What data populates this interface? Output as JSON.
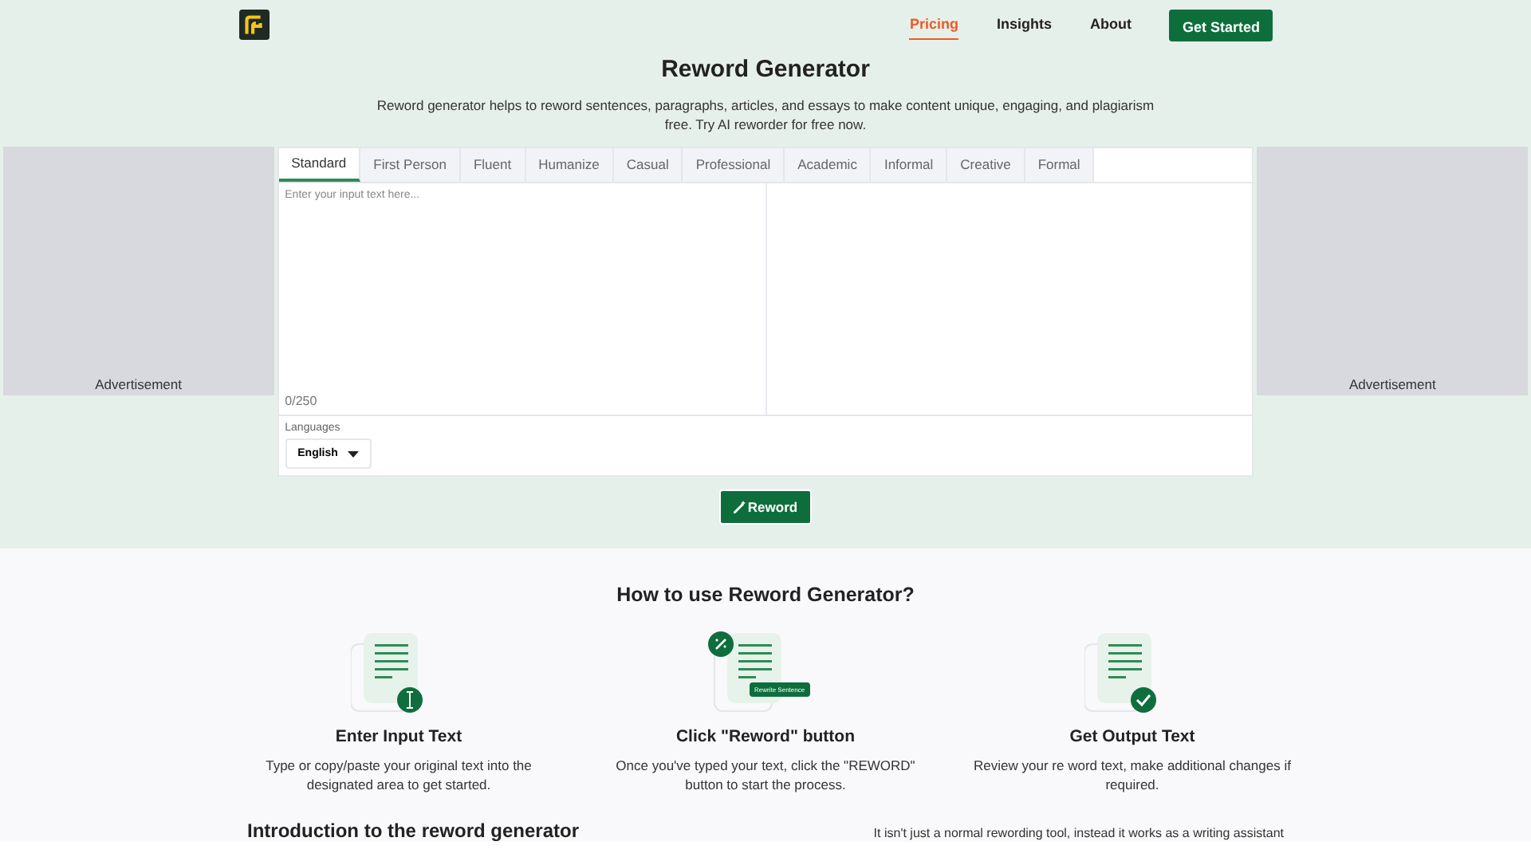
{
  "header": {
    "nav": [
      {
        "label": "Pricing",
        "selected": true
      },
      {
        "label": "Insights",
        "selected": false
      },
      {
        "label": "About",
        "selected": false
      }
    ],
    "cta": "Get Started"
  },
  "hero": {
    "title": "Reword Generator",
    "subtitle": "Reword generator helps to reword sentences, paragraphs, articles, and essays to make content unique, engaging, and plagiarism free. Try AI reworder for free now."
  },
  "ads": [
    "Advertisement",
    "Advertisement"
  ],
  "tabs": [
    {
      "label": "Standard",
      "selected": true
    },
    {
      "label": "First Person",
      "selected": false
    },
    {
      "label": "Fluent",
      "selected": false
    },
    {
      "label": "Humanize",
      "selected": false
    },
    {
      "label": "Casual",
      "selected": false
    },
    {
      "label": "Professional",
      "selected": false
    },
    {
      "label": "Academic",
      "selected": false
    },
    {
      "label": "Informal",
      "selected": false
    },
    {
      "label": "Creative",
      "selected": false
    },
    {
      "label": "Formal",
      "selected": false
    }
  ],
  "editor": {
    "placeholder": "Enter your input text here...",
    "counter": "0/250",
    "languages_label": "Languages",
    "language": "English",
    "button": "Reword"
  },
  "howto": {
    "title": "How to use Reword Generator?",
    "steps": [
      {
        "kind": "input",
        "title": "Enter Input Text",
        "text": "Type or copy/paste your original text into the designated area to get started."
      },
      {
        "kind": "click",
        "badge": "Rewrite Sentence",
        "title": "Click \"Reword\" button",
        "text": "Once you've typed your text, click the \"REWORD\" button to start the process."
      },
      {
        "kind": "output",
        "title": "Get Output Text",
        "text": "Review your re word text, make additional changes if required."
      }
    ]
  },
  "intro": {
    "title": "Introduction to the reword generator",
    "text": "It isn't just a normal rewording tool, instead it works as a writing assistant"
  }
}
